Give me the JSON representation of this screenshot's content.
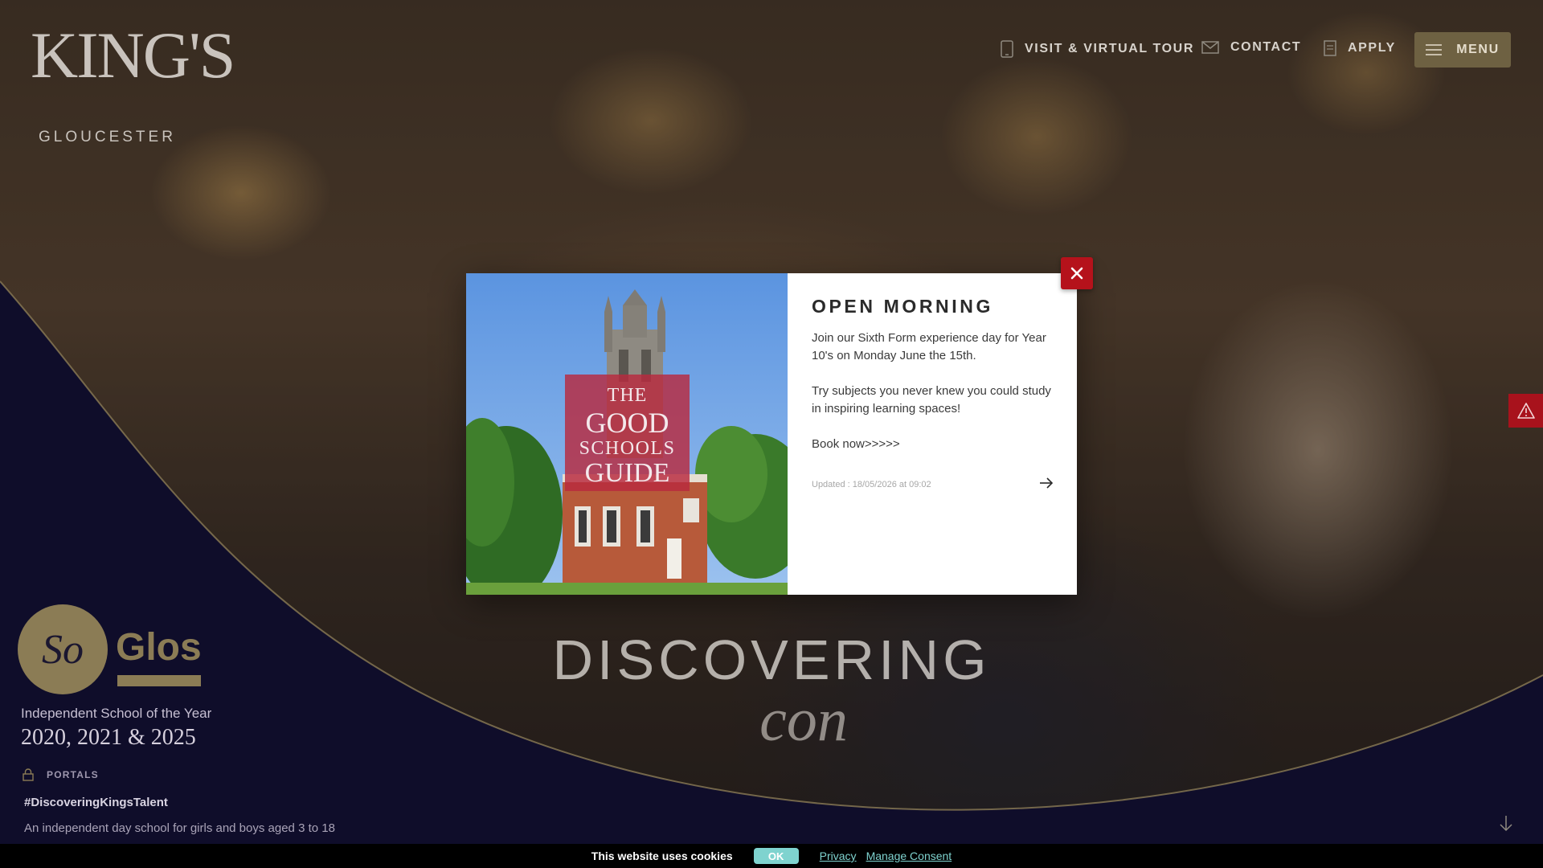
{
  "brand": {
    "logo_title": "KING'S",
    "logo_subtitle": "GLOUCESTER",
    "accent_color": "#8b7c55",
    "navy_color": "#0f0d2a",
    "alert_red": "#b5121b"
  },
  "nav": {
    "items": [
      {
        "label": "VISIT & VIRTUAL TOUR",
        "icon": "phone-icon"
      },
      {
        "label": "CONTACT",
        "icon": "mail-icon"
      },
      {
        "label": "APPLY",
        "icon": "document-icon"
      }
    ],
    "menu_label": "MENU",
    "menu_icon": "hamburger-icon"
  },
  "award": {
    "so": "So",
    "glos": "Glos",
    "line1": "Independent School of the Year",
    "line2": "2020, 2021 & 2025"
  },
  "portals": {
    "label": "PORTALS",
    "icon": "lock-icon"
  },
  "hashtag": "#DiscoveringKingsTalent",
  "tagline": "An independent day school for girls and boys aged 3 to 18",
  "hero": {
    "line1": "DISCOVERING",
    "line2": "con"
  },
  "modal": {
    "title": "OPEN MORNING",
    "paragraphs": [
      "Join our Sixth Form experience day for Year 10's on Monday June the 15th.",
      "Try subjects you never knew you could study in inspiring learning spaces!",
      "Book  now>>>>>"
    ],
    "updated": "Updated : 18/05/2026 at 09:02",
    "badge": {
      "line1": "THE",
      "line2": "GOOD",
      "line3": "SCHOOLS",
      "line4": "GUIDE"
    },
    "close_icon": "close-icon",
    "arrow_icon": "arrow-right-icon"
  },
  "cookie": {
    "text": "This website uses cookies",
    "ok_label": "OK",
    "privacy_label": "Privacy",
    "consent_label": "Manage Consent"
  },
  "icons": {
    "alert": "warning-icon",
    "scroll": "arrow-down-icon"
  }
}
